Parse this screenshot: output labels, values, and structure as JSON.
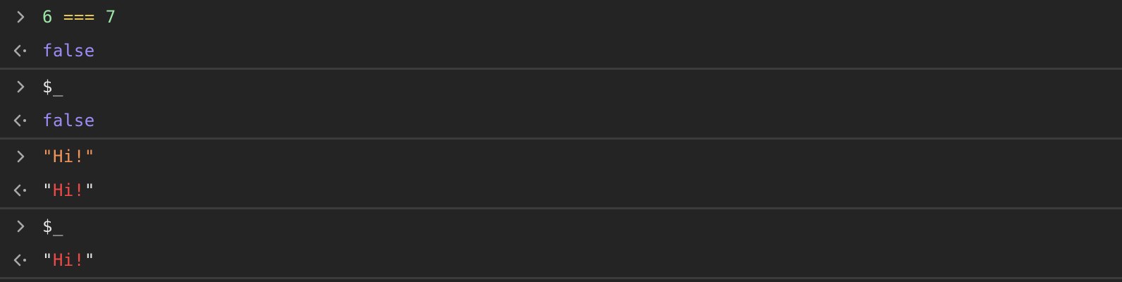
{
  "colors": {
    "background": "#242424",
    "divider": "#3c3c3c",
    "number": "#9ce6a8",
    "operator": "#e6c75a",
    "boolean": "#9d8cf5",
    "input_string": "#f2955a",
    "output_string": "#f04a48",
    "plain": "#e6e6e6",
    "prompt_icon": "#a8a8a8"
  },
  "icons": {
    "input": "chevron-right-icon",
    "output": "return-arrow-icon"
  },
  "entries": [
    {
      "input": {
        "left": "6",
        "op": "===",
        "right": "7"
      },
      "output": {
        "value": "false"
      }
    },
    {
      "input": {
        "text": "$_"
      },
      "output": {
        "value": "false"
      }
    },
    {
      "input": {
        "open_quote": "\"",
        "string": "Hi!",
        "close_quote": "\""
      },
      "output": {
        "open_quote": "\"",
        "string": "Hi!",
        "close_quote": "\""
      }
    },
    {
      "input": {
        "text": "$_"
      },
      "output": {
        "open_quote": "\"",
        "string": "Hi!",
        "close_quote": "\""
      }
    }
  ]
}
